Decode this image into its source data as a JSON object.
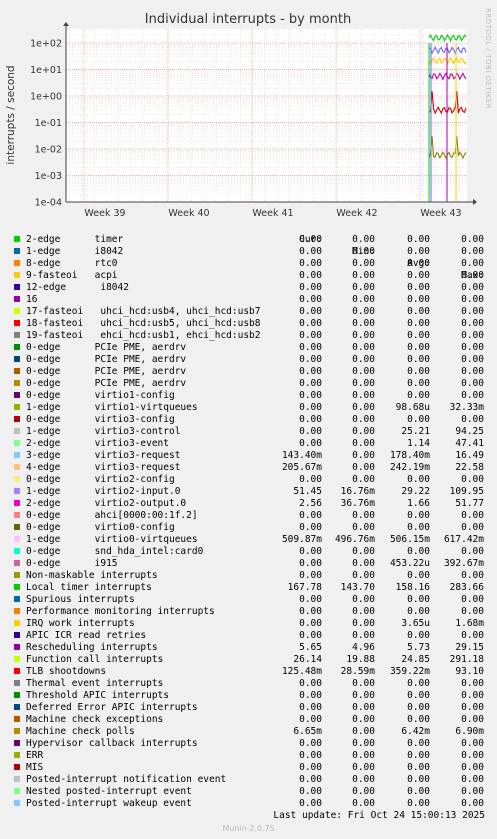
{
  "side_label": "RRDTOOL / TOBI OETIKER",
  "chart_data": {
    "type": "line",
    "title": "Individual interrupts - by month",
    "ylabel": "interrupts / second",
    "xlabel": "",
    "yscale": "log",
    "ylim": [
      0.0001,
      300
    ],
    "y_ticks": [
      "1e-04",
      "1e-03",
      "1e-02",
      "1e-01",
      "1e+00",
      "1e+01",
      "1e+02"
    ],
    "x_ticks": [
      "Week 39",
      "Week 40",
      "Week 41",
      "Week 42",
      "Week 43"
    ],
    "grid": true,
    "series": [
      {
        "name": "virtio3-request",
        "color": "#00cc00",
        "level": 160
      },
      {
        "name": "virtio0-virtqueues",
        "color": "#6666ff",
        "level": 55
      },
      {
        "name": "Local timer interrupts",
        "color": "#b000b0",
        "level": 5.7
      },
      {
        "name": "Rescheduling interrupts",
        "color": "#ffcc00",
        "level": 22
      },
      {
        "name": "Function call interrupts",
        "color": "#cc0000",
        "level": 0.3
      },
      {
        "name": "virtio1-config",
        "color": "#888800",
        "level": 0.006
      }
    ]
  },
  "legend": {
    "headers": {
      "cur": "Cur:",
      "min": "Min:",
      "avg": "Avg:",
      "max": "Max:"
    },
    "rows": [
      {
        "label": "2-edge      timer",
        "color": "#00cc00",
        "cur": "0.00",
        "min": "0.00",
        "avg": "0.00",
        "max": "0.00"
      },
      {
        "label": "1-edge      i8042",
        "color": "#0066b3",
        "cur": "0.00",
        "min": "0.00",
        "avg": "0.00",
        "max": "0.00"
      },
      {
        "label": "8-edge      rtc0",
        "color": "#ff8000",
        "cur": "0.00",
        "min": "0.00",
        "avg": "0.00",
        "max": "0.00"
      },
      {
        "label": "9-fasteoi   acpi",
        "color": "#ffcc00",
        "cur": "0.00",
        "min": "0.00",
        "avg": "0.00",
        "max": "0.00"
      },
      {
        "label": "12-edge      i8042",
        "color": "#330099",
        "cur": "0.00",
        "min": "0.00",
        "avg": "0.00",
        "max": "0.00"
      },
      {
        "label": "16",
        "color": "#990099",
        "cur": "0.00",
        "min": "0.00",
        "avg": "0.00",
        "max": "0.00"
      },
      {
        "label": "17-fasteoi   uhci_hcd:usb4, uhci_hcd:usb7",
        "color": "#ccff00",
        "cur": "0.00",
        "min": "0.00",
        "avg": "0.00",
        "max": "0.00"
      },
      {
        "label": "18-fasteoi   uhci_hcd:usb5, uhci_hcd:usb8",
        "color": "#ff0000",
        "cur": "0.00",
        "min": "0.00",
        "avg": "0.00",
        "max": "0.00"
      },
      {
        "label": "19-fasteoi   ehci_hcd:usb1, ehci_hcd:usb2",
        "color": "#808080",
        "cur": "0.00",
        "min": "0.00",
        "avg": "0.00",
        "max": "0.00"
      },
      {
        "label": "0-edge      PCIe PME, aerdrv",
        "color": "#008f00",
        "cur": "0.00",
        "min": "0.00",
        "avg": "0.00",
        "max": "0.00"
      },
      {
        "label": "0-edge      PCIe PME, aerdrv",
        "color": "#00487d",
        "cur": "0.00",
        "min": "0.00",
        "avg": "0.00",
        "max": "0.00"
      },
      {
        "label": "0-edge      PCIe PME, aerdrv",
        "color": "#b35a00",
        "cur": "0.00",
        "min": "0.00",
        "avg": "0.00",
        "max": "0.00"
      },
      {
        "label": "0-edge      PCIe PME, aerdrv",
        "color": "#b38f00",
        "cur": "0.00",
        "min": "0.00",
        "avg": "0.00",
        "max": "0.00"
      },
      {
        "label": "0-edge      virtio1-config",
        "color": "#6b006b",
        "cur": "0.00",
        "min": "0.00",
        "avg": "0.00",
        "max": "0.00"
      },
      {
        "label": "1-edge      virtio1-virtqueues",
        "color": "#8fb300",
        "cur": "0.00",
        "min": "0.00",
        "avg": "98.68u",
        "max": "32.33m"
      },
      {
        "label": "0-edge      virtio3-config",
        "color": "#b30000",
        "cur": "0.00",
        "min": "0.00",
        "avg": "0.00",
        "max": "0.00"
      },
      {
        "label": "1-edge      virtio3-control",
        "color": "#bebebe",
        "cur": "0.00",
        "min": "0.00",
        "avg": "25.21",
        "max": "94.25"
      },
      {
        "label": "2-edge      virtio3-event",
        "color": "#80ff80",
        "cur": "0.00",
        "min": "0.00",
        "avg": "1.14",
        "max": "47.41"
      },
      {
        "label": "3-edge      virtio3-request",
        "color": "#80c9ff",
        "cur": "143.40m",
        "min": "0.00",
        "avg": "178.40m",
        "max": "16.49"
      },
      {
        "label": "4-edge      virtio3-request",
        "color": "#ffc080",
        "cur": "205.67m",
        "min": "0.00",
        "avg": "242.19m",
        "max": "22.58"
      },
      {
        "label": "0-edge      virtio2-config",
        "color": "#ffe680",
        "cur": "0.00",
        "min": "0.00",
        "avg": "0.00",
        "max": "0.00"
      },
      {
        "label": "1-edge      virtio2-input.0",
        "color": "#aa80ff",
        "cur": "51.45",
        "min": "16.76m",
        "avg": "29.22",
        "max": "109.95"
      },
      {
        "label": "2-edge      virtio2-output.0",
        "color": "#ee00cc",
        "cur": "2.56",
        "min": "36.76m",
        "avg": "1.66",
        "max": "51.77"
      },
      {
        "label": "0-edge      ahci[0000:00:1f.2]",
        "color": "#ff8080",
        "cur": "0.00",
        "min": "0.00",
        "avg": "0.00",
        "max": "0.00"
      },
      {
        "label": "0-edge      virtio0-config",
        "color": "#666600",
        "cur": "0.00",
        "min": "0.00",
        "avg": "0.00",
        "max": "0.00"
      },
      {
        "label": "1-edge      virtio0-virtqueues",
        "color": "#ffbfff",
        "cur": "509.87m",
        "min": "496.76m",
        "avg": "506.15m",
        "max": "617.42m"
      },
      {
        "label": "0-edge      snd_hda_intel:card0",
        "color": "#00ffcc",
        "cur": "0.00",
        "min": "0.00",
        "avg": "0.00",
        "max": "0.00"
      },
      {
        "label": "0-edge      i915",
        "color": "#cc6699",
        "cur": "0.00",
        "min": "0.00",
        "avg": "453.22u",
        "max": "392.67m"
      },
      {
        "label": "Non-maskable interrupts",
        "color": "#999900",
        "cur": "0.00",
        "min": "0.00",
        "avg": "0.00",
        "max": "0.00"
      },
      {
        "label": "Local timer interrupts",
        "color": "#00cc00",
        "cur": "167.78",
        "min": "143.70",
        "avg": "158.16",
        "max": "283.66"
      },
      {
        "label": "Spurious interrupts",
        "color": "#0066b3",
        "cur": "0.00",
        "min": "0.00",
        "avg": "0.00",
        "max": "0.00"
      },
      {
        "label": "Performance monitoring interrupts",
        "color": "#ff8000",
        "cur": "0.00",
        "min": "0.00",
        "avg": "0.00",
        "max": "0.00"
      },
      {
        "label": "IRQ work interrupts",
        "color": "#ffcc00",
        "cur": "0.00",
        "min": "0.00",
        "avg": "3.65u",
        "max": "1.68m"
      },
      {
        "label": "APIC ICR read retries",
        "color": "#330099",
        "cur": "0.00",
        "min": "0.00",
        "avg": "0.00",
        "max": "0.00"
      },
      {
        "label": "Rescheduling interrupts",
        "color": "#990099",
        "cur": "5.65",
        "min": "4.96",
        "avg": "5.73",
        "max": "29.15"
      },
      {
        "label": "Function call interrupts",
        "color": "#ccff00",
        "cur": "26.14",
        "min": "19.88",
        "avg": "24.85",
        "max": "291.18"
      },
      {
        "label": "TLB shootdowns",
        "color": "#ff0000",
        "cur": "125.48m",
        "min": "28.59m",
        "avg": "359.22m",
        "max": "93.10"
      },
      {
        "label": "Thermal event interrupts",
        "color": "#808080",
        "cur": "0.00",
        "min": "0.00",
        "avg": "0.00",
        "max": "0.00"
      },
      {
        "label": "Threshold APIC interrupts",
        "color": "#008f00",
        "cur": "0.00",
        "min": "0.00",
        "avg": "0.00",
        "max": "0.00"
      },
      {
        "label": "Deferred Error APIC interrupts",
        "color": "#00487d",
        "cur": "0.00",
        "min": "0.00",
        "avg": "0.00",
        "max": "0.00"
      },
      {
        "label": "Machine check exceptions",
        "color": "#b35a00",
        "cur": "0.00",
        "min": "0.00",
        "avg": "0.00",
        "max": "0.00"
      },
      {
        "label": "Machine check polls",
        "color": "#b38f00",
        "cur": "6.65m",
        "min": "0.00",
        "avg": "6.42m",
        "max": "6.90m"
      },
      {
        "label": "Hypervisor callback interrupts",
        "color": "#6b006b",
        "cur": "0.00",
        "min": "0.00",
        "avg": "0.00",
        "max": "0.00"
      },
      {
        "label": "ERR",
        "color": "#8fb300",
        "cur": "0.00",
        "min": "0.00",
        "avg": "0.00",
        "max": "0.00"
      },
      {
        "label": "MIS",
        "color": "#b30000",
        "cur": "0.00",
        "min": "0.00",
        "avg": "0.00",
        "max": "0.00"
      },
      {
        "label": "Posted-interrupt notification event",
        "color": "#bebebe",
        "cur": "0.00",
        "min": "0.00",
        "avg": "0.00",
        "max": "0.00"
      },
      {
        "label": "Nested posted-interrupt event",
        "color": "#80ff80",
        "cur": "0.00",
        "min": "0.00",
        "avg": "0.00",
        "max": "0.00"
      },
      {
        "label": "Posted-interrupt wakeup event",
        "color": "#80c9ff",
        "cur": "0.00",
        "min": "0.00",
        "avg": "0.00",
        "max": "0.00"
      }
    ]
  },
  "last_update": "Last update: Fri Oct 24 15:00:13 2025",
  "munin_version": "Munin 2.0.75"
}
